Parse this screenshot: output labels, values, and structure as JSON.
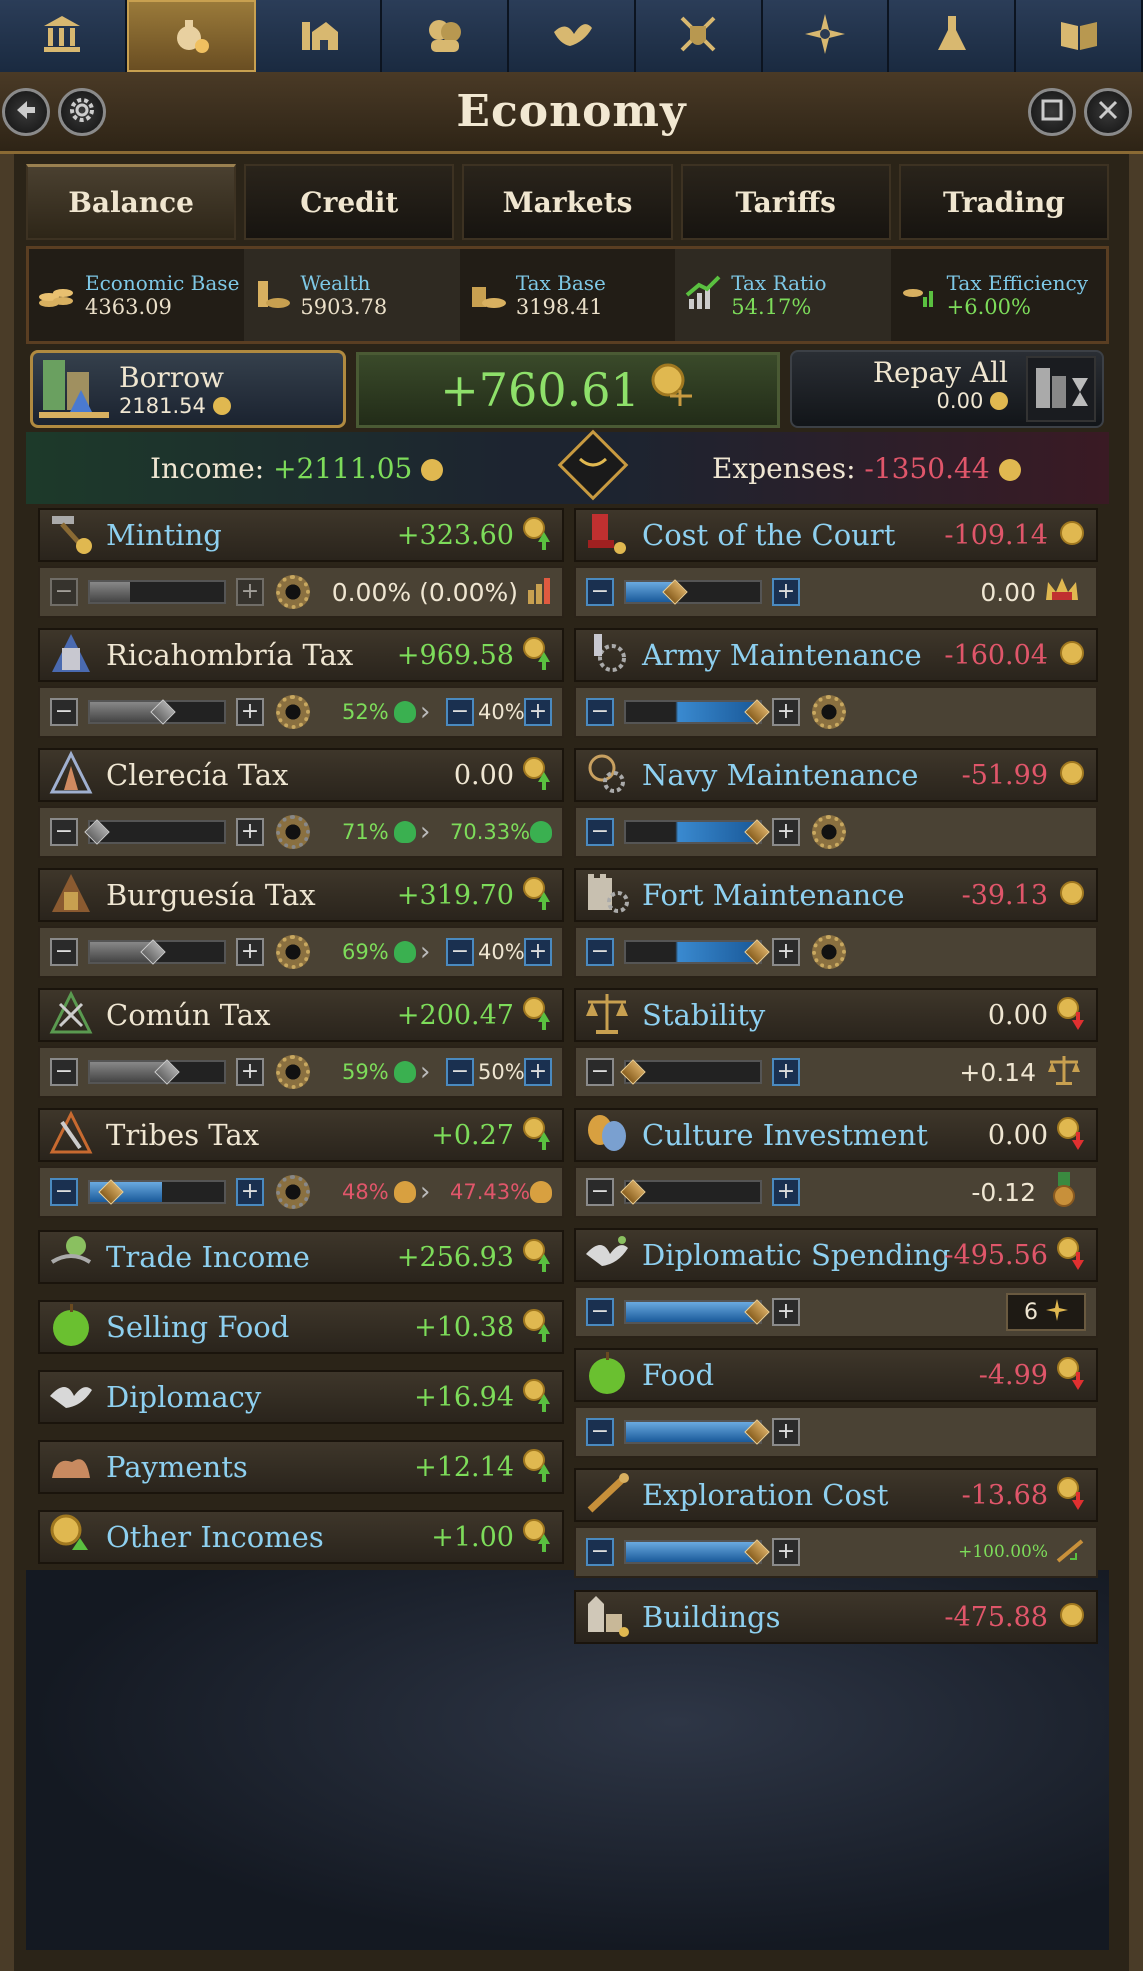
{
  "nav": {
    "tabs": [
      {
        "name": "government-icon"
      },
      {
        "name": "economy-icon"
      },
      {
        "name": "buildings-icon"
      },
      {
        "name": "population-icon"
      },
      {
        "name": "diplomacy-icon"
      },
      {
        "name": "military-icon"
      },
      {
        "name": "exploration-icon"
      },
      {
        "name": "research-icon"
      },
      {
        "name": "codex-icon"
      }
    ],
    "active_index": 1
  },
  "window": {
    "title": "Economy"
  },
  "tabs": {
    "balance": "Balance",
    "credit": "Credit",
    "markets": "Markets",
    "tariffs": "Tariffs",
    "trading": "Trading"
  },
  "stats": {
    "economic_base": {
      "label": "Economic Base",
      "value": "4363.09"
    },
    "wealth": {
      "label": "Wealth",
      "value": "5903.78"
    },
    "tax_base": {
      "label": "Tax Base",
      "value": "3198.41"
    },
    "tax_ratio": {
      "label": "Tax Ratio",
      "value": "54.17%"
    },
    "tax_efficiency": {
      "label": "Tax Efficiency",
      "value": "+6.00%"
    }
  },
  "borrow": {
    "label": "Borrow",
    "value": "2181.54"
  },
  "balance": {
    "value": "+760.61"
  },
  "repay": {
    "label": "Repay All",
    "value": "0.00"
  },
  "summary": {
    "income_label": "Income:",
    "income_value": "+2111.05",
    "expenses_label": "Expenses:",
    "expenses_value": "-1350.44"
  },
  "income": {
    "minting": {
      "label": "Minting",
      "value": "+323.60",
      "slider_text": "0.00% (0.00%)",
      "fill": 0.0
    },
    "ricahombria": {
      "label": "Ricahombría Tax",
      "value": "+969.58",
      "from": "52%",
      "to": "40%",
      "fill": 0.52
    },
    "clerecia": {
      "label": "Clerecía Tax",
      "value": "0.00",
      "from": "71%",
      "to": "70.33%",
      "fill": 0.0
    },
    "burguesia": {
      "label": "Burguesía Tax",
      "value": "+319.70",
      "from": "69%",
      "to": "40%",
      "fill": 0.45
    },
    "comun": {
      "label": "Común Tax",
      "value": "+200.47",
      "from": "59%",
      "to": "50%",
      "fill": 0.55
    },
    "tribes": {
      "label": "Tribes Tax",
      "value": "+0.27",
      "from": "48%",
      "to": "47.43%",
      "fill": 0.12
    },
    "trade": {
      "label": "Trade Income",
      "value": "+256.93"
    },
    "food": {
      "label": "Selling Food",
      "value": "+10.38"
    },
    "diplomacy": {
      "label": "Diplomacy",
      "value": "+16.94"
    },
    "payments": {
      "label": "Payments",
      "value": "+12.14"
    },
    "other": {
      "label": "Other Incomes",
      "value": "+1.00"
    }
  },
  "expenses": {
    "court": {
      "label": "Cost of the Court",
      "value": "-109.14",
      "sub_value": "0.00",
      "fill": 0.35
    },
    "army": {
      "label": "Army Maintenance",
      "value": "-160.04",
      "fill": 0.95
    },
    "navy": {
      "label": "Navy Maintenance",
      "value": "-51.99",
      "fill": 0.95
    },
    "fort": {
      "label": "Fort Maintenance",
      "value": "-39.13",
      "fill": 0.95
    },
    "stability": {
      "label": "Stability",
      "value": "0.00",
      "sub_value": "+0.14",
      "fill": 0.0
    },
    "culture": {
      "label": "Culture Investment",
      "value": "0.00",
      "sub_value": "-0.12",
      "fill": 0.0
    },
    "diplomatic": {
      "label": "Diplomatic Spending",
      "value": "-495.56",
      "sub_value": "6",
      "fill": 0.95
    },
    "food": {
      "label": "Food",
      "value": "-4.99",
      "fill": 0.95
    },
    "exploration": {
      "label": "Exploration Cost",
      "value": "-13.68",
      "sub_value": "+100.00%",
      "fill": 0.95
    },
    "buildings": {
      "label": "Buildings",
      "value": "-475.88"
    }
  },
  "colors": {
    "positive": "#7ddc5a",
    "negative": "#e0566a",
    "label_blue": "#8ed0f0",
    "gold": "#c8a050"
  }
}
